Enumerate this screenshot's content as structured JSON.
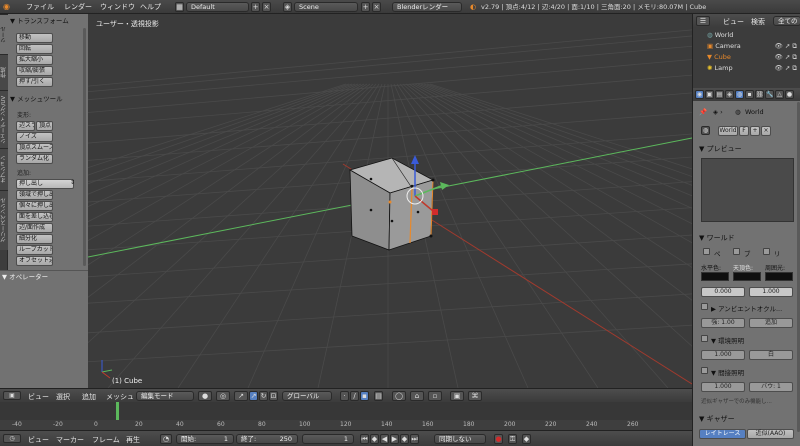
{
  "topbar": {
    "menus": [
      "ファイル",
      "レンダー",
      "ウィンドウ",
      "ヘルプ"
    ],
    "screen_layout": "Default",
    "scene": "Scene",
    "render_engine": "Blenderレンダー",
    "stats": "v2.79 | 頂点:4/12 | 辺:4/20 | 面:1/10 | 三角面:20 | メモリ:80.07M | Cube"
  },
  "tool_tabs": [
    "ツール",
    "作成",
    "シェーディング/UV",
    "オプション",
    "グリースペンシル"
  ],
  "toolshelf": {
    "transform_header": "▼ トランスフォーム",
    "transform_buttons": [
      "移動",
      "回転",
      "拡大縮小",
      "収縮/膨張",
      "押す/引く"
    ],
    "mesh_tools_header": "▼ メッシュツール",
    "deform_label": "変形:",
    "deform_row1": [
      "辺スライド",
      "頂点"
    ],
    "deform_buttons": [
      "ノイズ",
      "頂点スムーズ",
      "ランダム化"
    ],
    "add_label": "追加:",
    "extrude": "押し出し",
    "add_buttons": [
      "領域で押し出し",
      "個々に押し出し",
      "面を差し込む",
      "辺/面作成",
      "細分化",
      "ループカットと...",
      "オフセット辺ス..."
    ],
    "operator_header": "▼ オペレーター"
  },
  "viewport": {
    "view_label": "ユーザー・透視投影",
    "object_label": "(1) Cube"
  },
  "view3d_header": {
    "menus": [
      "ビュー",
      "選択",
      "追加",
      "メッシュ"
    ],
    "mode": "編集モード",
    "orientation": "グローバル"
  },
  "timeline": {
    "ticks": [
      "-40",
      "-20",
      "0",
      "20",
      "40",
      "60",
      "80",
      "100",
      "120",
      "140",
      "160",
      "180",
      "200",
      "220",
      "240",
      "260"
    ],
    "menus": [
      "ビュー",
      "マーカー",
      "フレーム",
      "再生"
    ],
    "start_label": "開始:",
    "start_value": "1",
    "end_label": "終了:",
    "end_value": "250",
    "current_frame": "1",
    "sync": "同期しない"
  },
  "outliner": {
    "menus": [
      "ビュー",
      "検索",
      "全てのシ"
    ],
    "items": [
      "World",
      "Camera",
      "Cube",
      "Lamp"
    ]
  },
  "properties": {
    "breadcrumb": "World",
    "world_field": "World",
    "fake_user": "F",
    "preview_header": "▼ プレビュー",
    "world_header": "▼ ワールド",
    "world_checks": [
      "ペ",
      "ブ",
      "リ"
    ],
    "horizon_label": "水平色:",
    "zenith_label": "天頂色:",
    "ambient_label": "周囲光:",
    "horizon_value": "0.000",
    "zenith_value": "1.000",
    "ao_header": "▶ アンビエントオクル...",
    "ao_strength": "強: 1.00",
    "ao_blend": "追加",
    "env_header": "▼ 環境照明",
    "env_value": "1.000",
    "env_color": "白",
    "indirect_header": "▼ 間接照明",
    "indirect_value": "1.000",
    "indirect_bounce": "バウ: 1",
    "indirect_note": "近似ギャザーでのみ機能し...",
    "gather_header": "▼ ギャザー",
    "gather_tabs": [
      "レイトレース",
      "近似(AAO)"
    ]
  },
  "colors": {
    "x_axis": "#c0392b",
    "y_axis": "#5cb85c",
    "z_axis": "#3a5bd9",
    "accent": "#5680c2"
  }
}
